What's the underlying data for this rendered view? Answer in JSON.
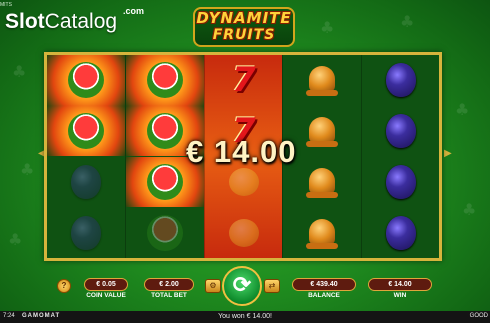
{
  "watermark": {
    "slot": "Slot",
    "catalog": "Catalog",
    "com": ".com"
  },
  "corner_text": "MITS",
  "logo": {
    "line1": "DYNAMITE",
    "line2": "FRUITS"
  },
  "reels": [
    [
      "watermelon",
      "watermelon",
      "plum",
      "plum"
    ],
    [
      "watermelon",
      "watermelon",
      "watermelon",
      "watermelon"
    ],
    [
      "seven",
      "seven",
      "lemon",
      "lemon"
    ],
    [
      "bell",
      "bell",
      "bell",
      "bell"
    ],
    [
      "plum",
      "plum",
      "plum",
      "plum"
    ]
  ],
  "highlighted_reel": 2,
  "win_amount": "€ 14.00",
  "controls": {
    "info_icon": "info-icon",
    "coin_value": "€ 0.05",
    "coin_value_label": "COIN VALUE",
    "total_bet": "€ 2.00",
    "total_bet_label": "TOTAL BET",
    "spin_icon": "spin-arrows-icon",
    "balance": "€ 439.40",
    "balance_label": "BALANCE",
    "win": "€ 14.00",
    "win_label": "WIN"
  },
  "status_bar": {
    "time": "7:24",
    "brand": "GAMOMAT",
    "message": "You won € 14.00!",
    "right": "GOOD"
  },
  "colors": {
    "accent_gold": "#d6b43c",
    "background_green": "#1f8b1f",
    "pill_bg": "#5e1b0f"
  }
}
